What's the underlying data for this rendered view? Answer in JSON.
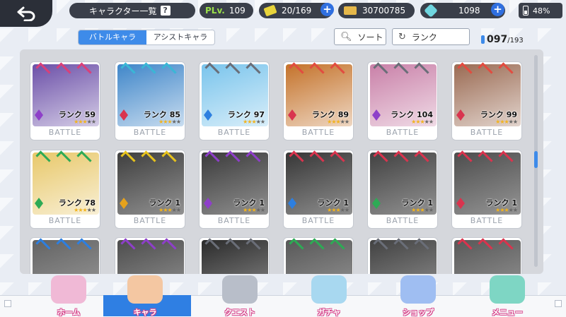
{
  "topbar": {
    "screen_title": "キャラクター一覧",
    "help_icon": "?",
    "player_level_label": "PLv.",
    "player_level": "109",
    "stamina": "20/169",
    "gold": "30700785",
    "gems": "1098",
    "battery": "48%"
  },
  "tabs": [
    "バトルキャラ",
    "アシストキャラ"
  ],
  "controls": {
    "sort_label": "ソート",
    "rank_label": "ランク",
    "count_current": "097",
    "count_total": "/193"
  },
  "card_footer": "BATTLE",
  "cards": [
    {
      "rank": "ランク 59",
      "stars": 3,
      "gem": "#8e3fc9",
      "elem": "#d9407a",
      "art": "#6b4fa8",
      "locked": false
    },
    {
      "rank": "ランク 85",
      "stars": 3,
      "gem": "#d9344e",
      "elem": "#3ab7d6",
      "art": "#3f86c9",
      "locked": false
    },
    {
      "rank": "ランク 97",
      "stars": 3,
      "gem": "#2d7fe0",
      "elem": "#6a6e78",
      "art": "#79c4ec",
      "locked": false
    },
    {
      "rank": "ランク 89",
      "stars": 3,
      "gem": "#d9344e",
      "elem": "#e24c40",
      "art": "#c4722a",
      "locked": false
    },
    {
      "rank": "ランク 104",
      "stars": 3,
      "gem": "#8e3fc9",
      "elem": "#6a6e78",
      "art": "#c980a8",
      "locked": false
    },
    {
      "rank": "ランク 99",
      "stars": 3,
      "gem": "#d9344e",
      "elem": "#e24c40",
      "art": "#9a6a52",
      "locked": false
    },
    {
      "rank": "ランク 78",
      "stars": 3,
      "gem": "#2eaa55",
      "elem": "#2eaa55",
      "art": "#e8c86a",
      "locked": false
    },
    {
      "rank": "ランク 1",
      "stars": 3,
      "gem": "#e6a21c",
      "elem": "#e6c21c",
      "art": "#555a64",
      "locked": true
    },
    {
      "rank": "ランク 1",
      "stars": 3,
      "gem": "#8e3fc9",
      "elem": "#8e3fc9",
      "art": "#50555e",
      "locked": true
    },
    {
      "rank": "ランク 1",
      "stars": 3,
      "gem": "#2d7fe0",
      "elem": "#d9344e",
      "art": "#4a4e57",
      "locked": true
    },
    {
      "rank": "ランク 1",
      "stars": 3,
      "gem": "#2eaa55",
      "elem": "#d9344e",
      "art": "#5a5e67",
      "locked": true
    },
    {
      "rank": "ランク 1",
      "stars": 3,
      "gem": "#d9344e",
      "elem": "#d9344e",
      "art": "#6a6e78",
      "locked": true
    },
    {
      "rank": "",
      "stars": 0,
      "gem": "",
      "elem": "#2d7fe0",
      "art": "#8a8e96",
      "locked": true
    },
    {
      "rank": "",
      "stars": 0,
      "gem": "",
      "elem": "#8e3fc9",
      "art": "#6a6e78",
      "locked": true
    },
    {
      "rank": "",
      "stars": 0,
      "gem": "",
      "elem": "#6a6e78",
      "art": "#3a3d44",
      "locked": true
    },
    {
      "rank": "",
      "stars": 0,
      "gem": "",
      "elem": "#2eaa55",
      "art": "#7a7e87",
      "locked": true
    },
    {
      "rank": "",
      "stars": 0,
      "gem": "",
      "elem": "#6a6e78",
      "art": "#5a5e67",
      "locked": true
    },
    {
      "rank": "",
      "stars": 0,
      "gem": "",
      "elem": "#d9344e",
      "art": "#7a7e87",
      "locked": true
    }
  ],
  "nav": [
    {
      "label": "ホーム",
      "color": "#f0b9d6",
      "active": false
    },
    {
      "label": "キャラ",
      "color": "#f4c7a2",
      "active": true
    },
    {
      "label": "クエスト",
      "color": "#b8bec9",
      "active": false
    },
    {
      "label": "ガチャ",
      "color": "#a8d8f0",
      "active": false
    },
    {
      "label": "ショップ",
      "color": "#9fbef2",
      "active": false
    },
    {
      "label": "メニュー",
      "color": "#7ed6c4",
      "active": false
    }
  ]
}
